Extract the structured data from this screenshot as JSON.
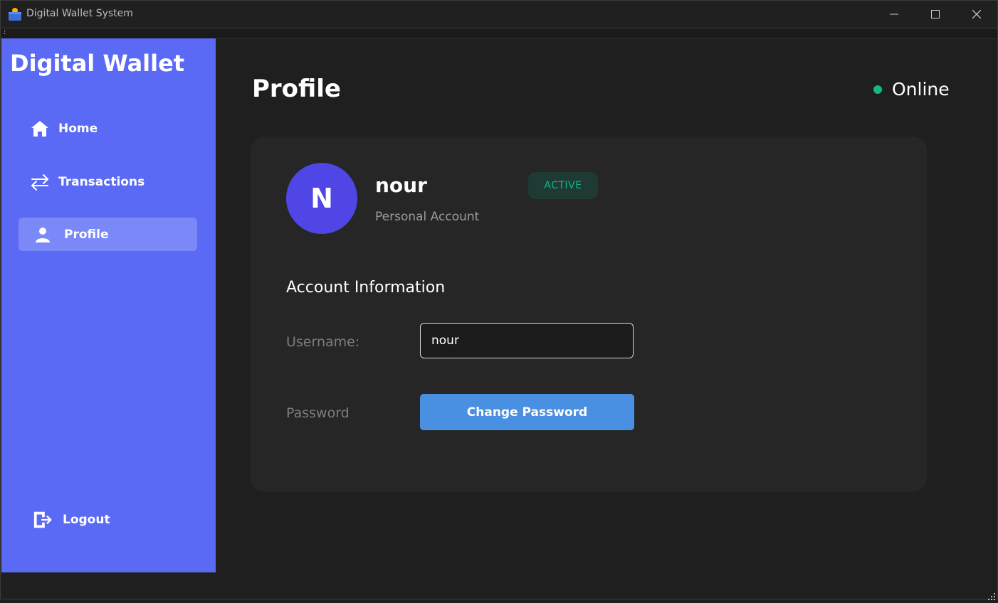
{
  "window": {
    "title": "Digital Wallet System",
    "icon": "wallet-icon",
    "controls": [
      "minimize-icon",
      "maximize-icon",
      "close-icon"
    ]
  },
  "menu": {
    "glyph": ":"
  },
  "sidebar": {
    "brand": "Digital Wallet",
    "items": [
      {
        "label": "Home",
        "icon": "home-icon",
        "active": false
      },
      {
        "label": "Transactions",
        "icon": "arrows-exchange-icon",
        "active": false
      },
      {
        "label": "Profile",
        "icon": "user-icon",
        "active": true
      }
    ],
    "logout": {
      "label": "Logout",
      "icon": "logout-icon"
    },
    "bg_color": "#5b6af5",
    "active_bg_color": "#7b88f8"
  },
  "header": {
    "title": "Profile",
    "status_text": "Online",
    "status_color": "#10b981"
  },
  "profile": {
    "avatar_initial": "N",
    "avatar_color": "#4f46e5",
    "username": "nour",
    "account_type": "Personal Account",
    "status_badge": "ACTIVE"
  },
  "account_info": {
    "title": "Account Information",
    "username_label": "Username:",
    "username_value": "nour",
    "password_label": "Password",
    "change_password_label": "Change Password",
    "button_color": "#4a90e2"
  }
}
